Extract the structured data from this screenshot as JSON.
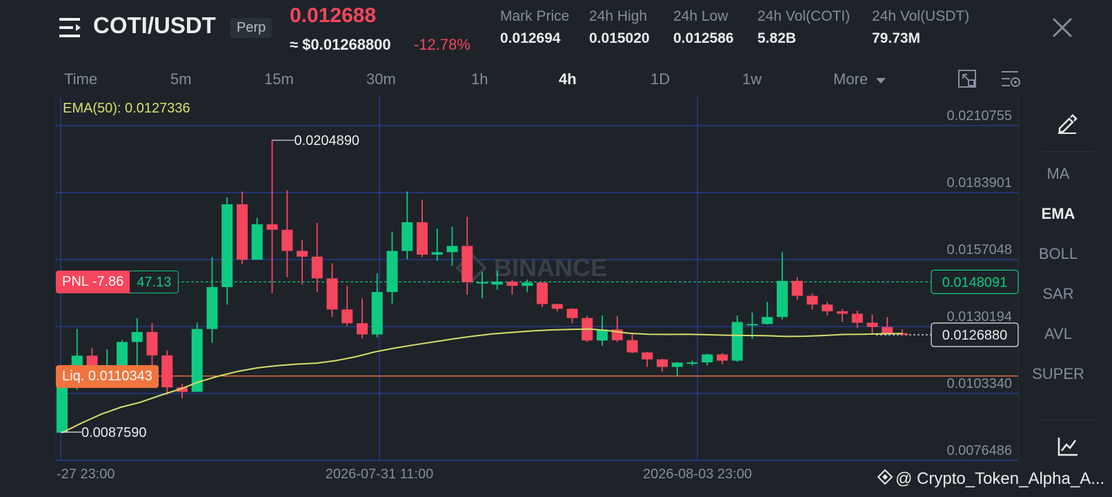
{
  "header": {
    "pair": "COTI/USDT",
    "badge": "Perp",
    "last_price": "0.012688",
    "approx_usd": "≈ $0.01268800",
    "change": "-12.78%",
    "stats": [
      {
        "label": "Mark Price",
        "value": "0.012694"
      },
      {
        "label": "24h High",
        "value": "0.015020"
      },
      {
        "label": "24h Low",
        "value": "0.012586"
      },
      {
        "label": "24h Vol(COTI)",
        "value": "5.82B"
      },
      {
        "label": "24h Vol(USDT)",
        "value": "79.73M"
      }
    ]
  },
  "timeframes": [
    "Time",
    "5m",
    "15m",
    "30m",
    "1h",
    "4h",
    "1D",
    "1w",
    "More"
  ],
  "active_timeframe": "4h",
  "sidebar": {
    "items": [
      "MA",
      "EMA",
      "BOLL",
      "SAR",
      "AVL",
      "SUPER"
    ],
    "active": "EMA"
  },
  "chart_data": {
    "type": "candlestick",
    "indicator_label": "EMA(50): 0.0127336",
    "y_ticks": [
      "0.0210755",
      "0.0183901",
      "0.0157048",
      "0.0130194",
      "0.0103340",
      "0.0076486"
    ],
    "y_tick_values": [
      0.0210755,
      0.0183901,
      0.0157048,
      0.0130194,
      0.010334,
      0.0076486
    ],
    "x_ticks": [
      "-27 23:00",
      "2026-07-31 11:00",
      "2026-08-03 23:00"
    ],
    "high_label": "0.0204890",
    "low_label": "0.0087590",
    "entry_price": "0.0148091",
    "current_price": "0.0126880",
    "pnl_label": "PNL -7.86",
    "pnl_value": "47.13",
    "liq_label": "Liq. 0.0110343",
    "watermark": "BINANCE",
    "candles": [
      [
        0.00876,
        0.01075,
        0.00876,
        0.01093
      ],
      [
        0.01075,
        0.01185,
        0.01048,
        0.01292
      ],
      [
        0.01185,
        0.01085,
        0.01082,
        0.01215
      ],
      [
        0.01085,
        0.01132,
        0.0107,
        0.0121
      ],
      [
        0.01132,
        0.0124,
        0.01082,
        0.01248
      ],
      [
        0.0124,
        0.0128,
        0.01125,
        0.01335
      ],
      [
        0.0128,
        0.01186,
        0.01124,
        0.01315
      ],
      [
        0.01186,
        0.01058,
        0.01028,
        0.01206
      ],
      [
        0.01058,
        0.0104,
        0.01014,
        0.01072
      ],
      [
        0.0104,
        0.01292,
        0.0104,
        0.01318
      ],
      [
        0.01292,
        0.0146,
        0.01236,
        0.0158
      ],
      [
        0.0146,
        0.01792,
        0.0139,
        0.0182
      ],
      [
        0.01792,
        0.0157,
        0.01552,
        0.01843
      ],
      [
        0.0157,
        0.01712,
        0.0157,
        0.01738
      ],
      [
        0.01712,
        0.0169,
        0.01435,
        0.02049
      ],
      [
        0.0169,
        0.01605,
        0.015,
        0.01848
      ],
      [
        0.01605,
        0.01582,
        0.0147,
        0.0165
      ],
      [
        0.01582,
        0.01495,
        0.0144,
        0.01718
      ],
      [
        0.01495,
        0.0137,
        0.0134,
        0.01555
      ],
      [
        0.0137,
        0.01315,
        0.01304,
        0.01465
      ],
      [
        0.01315,
        0.0127,
        0.01254,
        0.01414
      ],
      [
        0.0127,
        0.0144,
        0.01258,
        0.01515
      ],
      [
        0.0144,
        0.01605,
        0.01394,
        0.01682
      ],
      [
        0.01605,
        0.0172,
        0.01572,
        0.01843
      ],
      [
        0.0172,
        0.0159,
        0.0158,
        0.0181
      ],
      [
        0.0159,
        0.016,
        0.01565,
        0.01695
      ],
      [
        0.016,
        0.01625,
        0.01545,
        0.01702
      ],
      [
        0.01625,
        0.0148,
        0.0143,
        0.01742
      ],
      [
        0.0148,
        0.0148,
        0.01415,
        0.0152
      ],
      [
        0.0147,
        0.01482,
        0.0145,
        0.01525
      ],
      [
        0.01482,
        0.01465,
        0.0143,
        0.01488
      ],
      [
        0.01465,
        0.01478,
        0.0144,
        0.0149
      ],
      [
        0.01478,
        0.01392,
        0.0138,
        0.0148
      ],
      [
        0.01392,
        0.01373,
        0.01362,
        0.01394
      ],
      [
        0.01373,
        0.01336,
        0.01316,
        0.01375
      ],
      [
        0.01336,
        0.01246,
        0.0124,
        0.01344
      ],
      [
        0.01246,
        0.0129,
        0.01225,
        0.01346
      ],
      [
        0.0129,
        0.01247,
        0.0124,
        0.01345
      ],
      [
        0.01247,
        0.01198,
        0.01195,
        0.01275
      ],
      [
        0.01198,
        0.0117,
        0.0114,
        0.012
      ],
      [
        0.0117,
        0.0114,
        0.0112,
        0.01172
      ],
      [
        0.0114,
        0.01157,
        0.01105,
        0.0116
      ],
      [
        0.01157,
        0.01158,
        0.01145,
        0.01165
      ],
      [
        0.01158,
        0.0119,
        0.01146,
        0.01193
      ],
      [
        0.0119,
        0.01165,
        0.0115,
        0.01195
      ],
      [
        0.01165,
        0.0132,
        0.0116,
        0.01346
      ],
      [
        0.0131,
        0.01312,
        0.01253,
        0.01358
      ],
      [
        0.01312,
        0.0134,
        0.0131,
        0.014
      ],
      [
        0.0134,
        0.01485,
        0.0133,
        0.016
      ],
      [
        0.01485,
        0.01425,
        0.0141,
        0.015
      ],
      [
        0.01425,
        0.0139,
        0.0137,
        0.01435
      ],
      [
        0.0139,
        0.01363,
        0.01346,
        0.014
      ],
      [
        0.01363,
        0.01353,
        0.0132,
        0.01372
      ],
      [
        0.01353,
        0.01317,
        0.01296,
        0.01366
      ],
      [
        0.01317,
        0.013,
        0.0127,
        0.0135
      ],
      [
        0.013,
        0.01275,
        0.0127,
        0.0134
      ],
      [
        0.01275,
        0.01269,
        0.01265,
        0.0129
      ]
    ],
    "ema": [
      0.00876,
      0.00915,
      0.0095,
      0.00978,
      0.00998,
      0.01025,
      0.0105,
      0.0108,
      0.01103,
      0.01122,
      0.01136,
      0.01145,
      0.01151,
      0.01155,
      0.01165,
      0.0118,
      0.012,
      0.01215,
      0.01228,
      0.0124,
      0.01252,
      0.01263,
      0.01272,
      0.01278,
      0.01284,
      0.01288,
      0.0129,
      0.01292,
      0.01285,
      0.01275,
      0.01271,
      0.0127,
      0.01271,
      0.01269,
      0.01267,
      0.01266,
      0.01265,
      0.01262,
      0.01263,
      0.01266,
      0.0127,
      0.01271,
      0.01273,
      0.01274
    ]
  },
  "watermark_credit": "@ Crypto_Token_Alpha_A...",
  "colors": {
    "up": "#0ecb81",
    "down": "#f6465d",
    "ema": "#d6e06a",
    "grid": "#2a3ea8",
    "liq": "#f0743e",
    "background": "#1e2329"
  }
}
